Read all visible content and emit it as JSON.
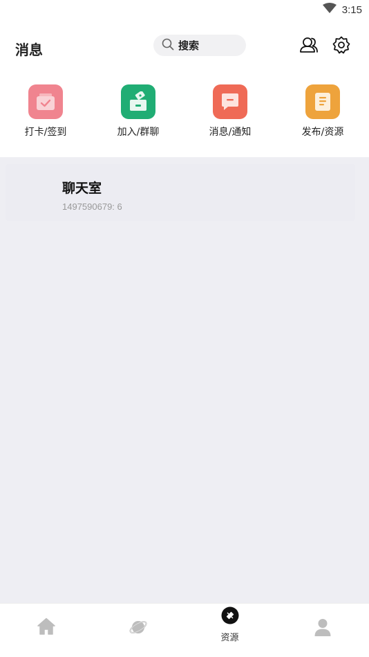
{
  "status_bar": {
    "time": "3:15"
  },
  "header": {
    "title": "消息",
    "search_label": "搜索"
  },
  "actions": [
    {
      "label": "打卡/签到",
      "color": "#f0848f",
      "icon": "checkin-icon"
    },
    {
      "label": "加入/群聊",
      "color": "#20ad74",
      "icon": "join-group-icon"
    },
    {
      "label": "消息/通知",
      "color": "#ef6a56",
      "icon": "message-icon"
    },
    {
      "label": "发布/资源",
      "color": "#eea33c",
      "icon": "publish-icon"
    }
  ],
  "chats": [
    {
      "title": "聊天室",
      "preview": "1497590679: 6"
    }
  ],
  "bottom_nav": [
    {
      "icon": "home-icon",
      "label": ""
    },
    {
      "icon": "planet-icon",
      "label": ""
    },
    {
      "icon": "resource-icon",
      "label": "资源",
      "active": true
    },
    {
      "icon": "user-icon",
      "label": ""
    }
  ]
}
